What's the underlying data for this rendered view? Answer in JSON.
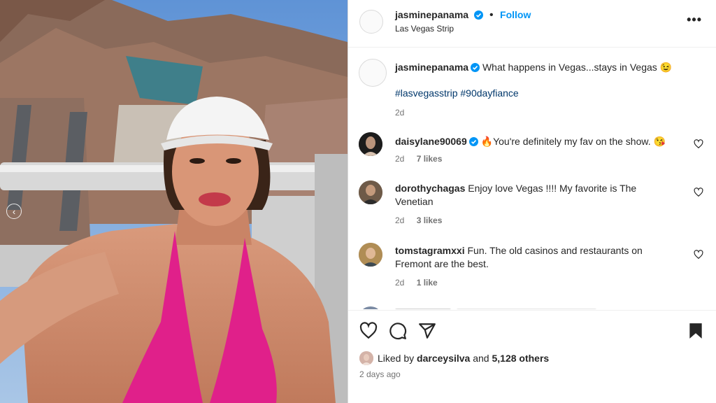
{
  "post": {
    "author": "jasminepanama",
    "follow_label": "Follow",
    "location": "Las Vegas Strip",
    "more_icon": "more-horizontal-icon"
  },
  "caption": {
    "author": "jasminepanama",
    "text": "What happens in Vegas...stays in Vegas 😉",
    "hashtag1": "#lasvegasstrip",
    "hashtag2": "#90dayfiance",
    "age": "2d"
  },
  "comments": [
    {
      "user": "daisylane90069",
      "text": "🔥You're definitely my fav on the show. 😘",
      "age": "2d",
      "likes": "7 likes",
      "verified": true
    },
    {
      "user": "dorothychagas",
      "text": "Enjoy love Vegas !!!! My favorite is The Venetian",
      "age": "2d",
      "likes": "3 likes",
      "verified": false
    },
    {
      "user": "tomstagramxxi",
      "text": "Fun. The old casinos and restaurants on Fremont are the best.",
      "age": "2d",
      "likes": "1 like",
      "verified": false
    }
  ],
  "liked": {
    "prefix": "Liked by",
    "user": "darceysilva",
    "and": "and",
    "others": "5,128 others"
  },
  "time_ago": "2 days ago",
  "colors": {
    "link": "#0095f6",
    "hashtag": "#00376b",
    "bikini": "#e0208a"
  }
}
